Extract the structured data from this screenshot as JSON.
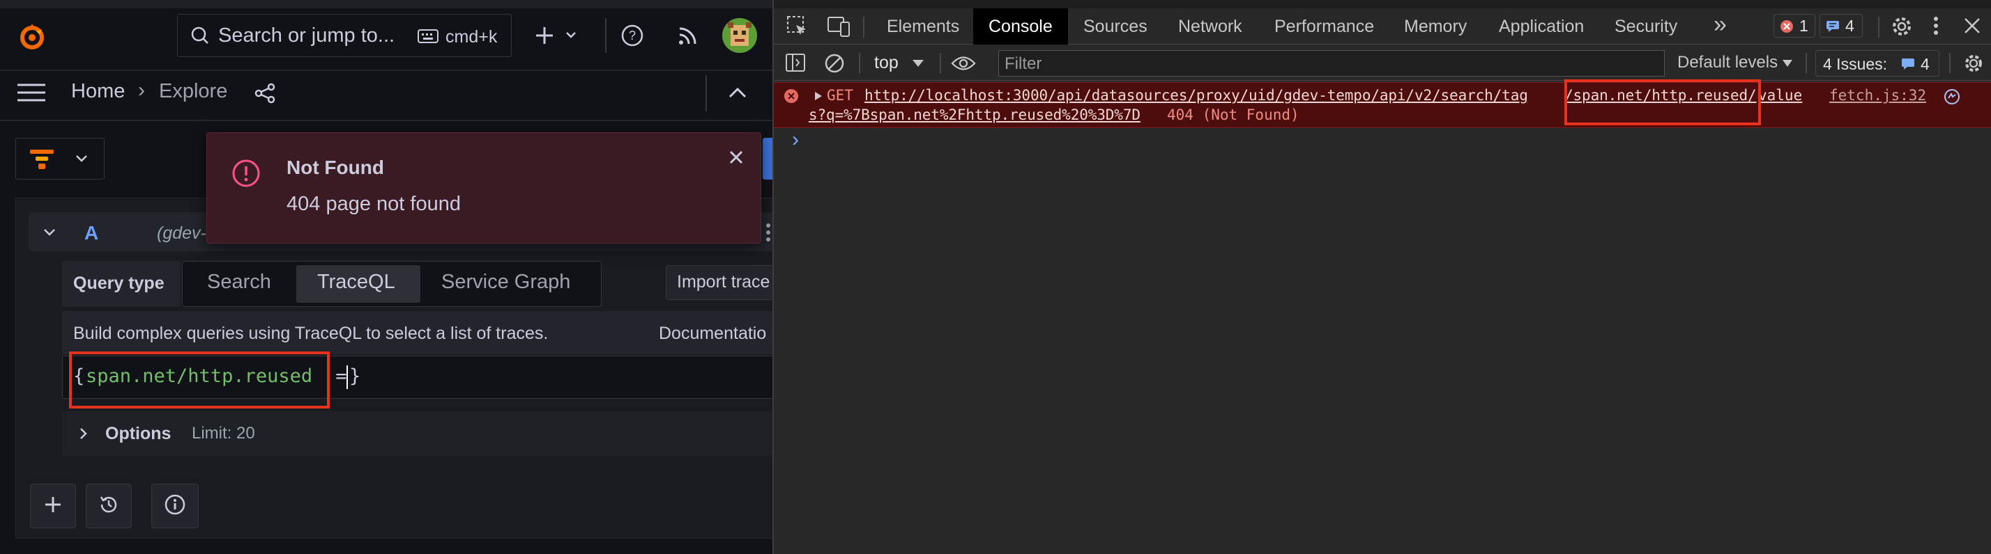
{
  "grafana": {
    "search_placeholder": "Search or jump to...",
    "shortcut": "cmd+k",
    "breadcrumb": {
      "home": "Home",
      "sep": "›",
      "current": "Explore"
    },
    "query_row": {
      "label": "A",
      "datasource_hint": "(gdev-"
    },
    "query_type_label": "Query type",
    "query_tabs": [
      "Search",
      "TraceQL",
      "Service Graph"
    ],
    "active_tab": "TraceQL",
    "import_trace": "Import trace",
    "help_text": "Build complex queries using TraceQL to select a list of traces.",
    "documentation": "Documentatio",
    "editor": {
      "open_brace": "{",
      "tag": "span.net/http.reused",
      "operator": " =",
      "close_brace": "}"
    },
    "options": {
      "label": "Options",
      "limit": "Limit: 20"
    },
    "toast": {
      "title": "Not Found",
      "message": "404 page not found"
    },
    "icons": [
      "grafana-logo-icon",
      "search-icon",
      "keyboard-icon",
      "plus-icon",
      "chevron-down-icon",
      "help-icon",
      "rss-icon",
      "avatar",
      "menu-icon",
      "share-icon",
      "chevron-up-icon",
      "tempo-logo-icon",
      "alert-icon",
      "close-icon",
      "plus-icon",
      "history-icon",
      "info-icon"
    ]
  },
  "devtools": {
    "tabs": [
      "Elements",
      "Console",
      "Sources",
      "Network",
      "Performance",
      "Memory",
      "Application",
      "Security"
    ],
    "active_tab": "Console",
    "more_tabs": "»",
    "error_count": "1",
    "message_count": "4",
    "context": "top",
    "filter_placeholder": "Filter",
    "levels": "Default levels",
    "issues_label": "4 Issues:",
    "issues_count": "4",
    "log": {
      "method": "GET",
      "url_line1_a": "http://localhost:3000/api/datasources/proxy/uid/gdev-tempo/api/v2/search/tag",
      "url_line1_b": "/span.net/http.reused/",
      "url_line1_c": "value",
      "source": "fetch.js:32",
      "url_line2": "s?q=%7Bspan.net%2Fhttp.reused%20%3D%7D",
      "status": "404 (Not Found)"
    },
    "prompt": "›"
  },
  "colors": {
    "grafana_bg": "#111217",
    "grafana_panel": "#181b1f",
    "accent_orange": "#f46800",
    "editor_tag": "#73bf69",
    "highlight_red": "#e8321e",
    "devtools_bg": "#282828",
    "error_bg": "#4e0d0d",
    "error_text": "#f28b82"
  }
}
